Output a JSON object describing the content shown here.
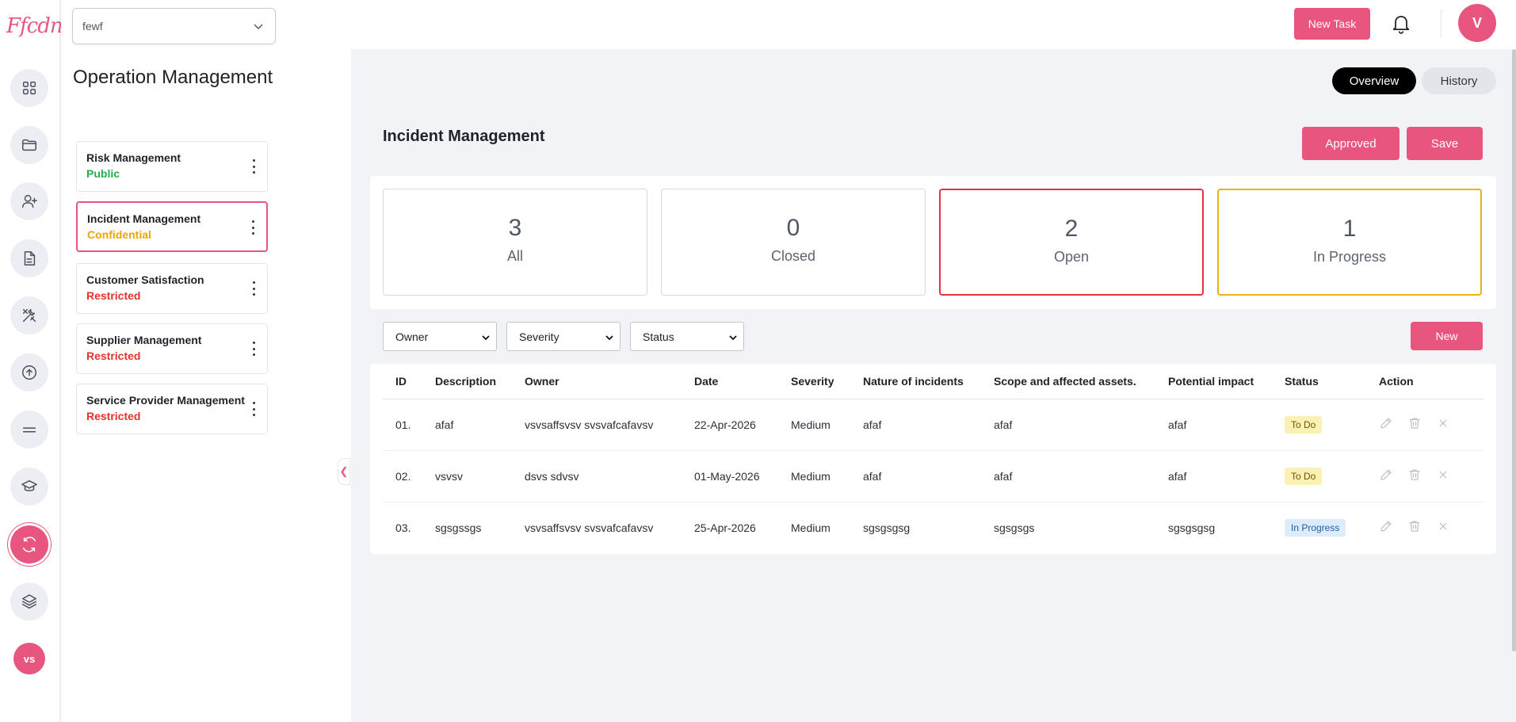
{
  "app": {
    "logo_text": "Ffcdn",
    "brand_color": "#e8557f"
  },
  "rail": {
    "items": [
      {
        "icon": "dashboard-grid-icon"
      },
      {
        "icon": "folder-icon"
      },
      {
        "icon": "add-user-icon"
      },
      {
        "icon": "document-icon"
      },
      {
        "icon": "tools-icon"
      },
      {
        "icon": "upload-icon"
      },
      {
        "icon": "menu-lines-icon"
      },
      {
        "icon": "graduation-cap-icon"
      },
      {
        "icon": "sync-icon",
        "active": true
      },
      {
        "icon": "layers-icon"
      }
    ],
    "user_initials": "vs"
  },
  "sidebar": {
    "workspace_value": "fewf",
    "title": "Operation Management",
    "projects": [
      {
        "name": "Risk Management",
        "visibility": "Public"
      },
      {
        "name": "Incident Management",
        "visibility": "Confidential",
        "active": true
      },
      {
        "name": "Customer Satisfaction",
        "visibility": "Restricted"
      },
      {
        "name": "Supplier Management",
        "visibility": "Restricted"
      },
      {
        "name": "Service Provider Management",
        "visibility": "Restricted"
      }
    ]
  },
  "topbar": {
    "new_task_label": "New Task",
    "avatar_initial": "V"
  },
  "main": {
    "tabs": {
      "overview": "Overview",
      "history": "History"
    },
    "title": "Incident Management",
    "approved_label": "Approved",
    "save_label": "Save",
    "stats": [
      {
        "count": "3",
        "label": "All"
      },
      {
        "count": "0",
        "label": "Closed"
      },
      {
        "count": "2",
        "label": "Open"
      },
      {
        "count": "1",
        "label": "In Progress"
      }
    ],
    "filters": {
      "owner": "Owner",
      "severity": "Severity",
      "status": "Status"
    },
    "new_label": "New",
    "table": {
      "headers": [
        "ID",
        "Description",
        "Owner",
        "Date",
        "Severity",
        "Nature of incidents",
        "Scope and affected assets.",
        "Potential impact",
        "Status",
        "Action"
      ],
      "rows": [
        {
          "id": "01.",
          "description": "afaf",
          "owner": "vsvsaffsvsv svsvafcafavsv",
          "date": "22-Apr-2026",
          "severity": "Medium",
          "nature": "afaf",
          "scope": "afaf",
          "impact": "afaf",
          "status": "To Do"
        },
        {
          "id": "02.",
          "description": "vsvsv",
          "owner": "dsvs sdvsv",
          "date": "01-May-2026",
          "severity": "Medium",
          "nature": "afaf",
          "scope": "afaf",
          "impact": "afaf",
          "status": "To Do"
        },
        {
          "id": "03.",
          "description": "sgsgssgs",
          "owner": "vsvsaffsvsv svsvafcafavsv",
          "date": "25-Apr-2026",
          "severity": "Medium",
          "nature": "sgsgsgsg",
          "scope": "sgsgsgs",
          "impact": "sgsgsgsg",
          "status": "In Progress"
        }
      ]
    }
  }
}
